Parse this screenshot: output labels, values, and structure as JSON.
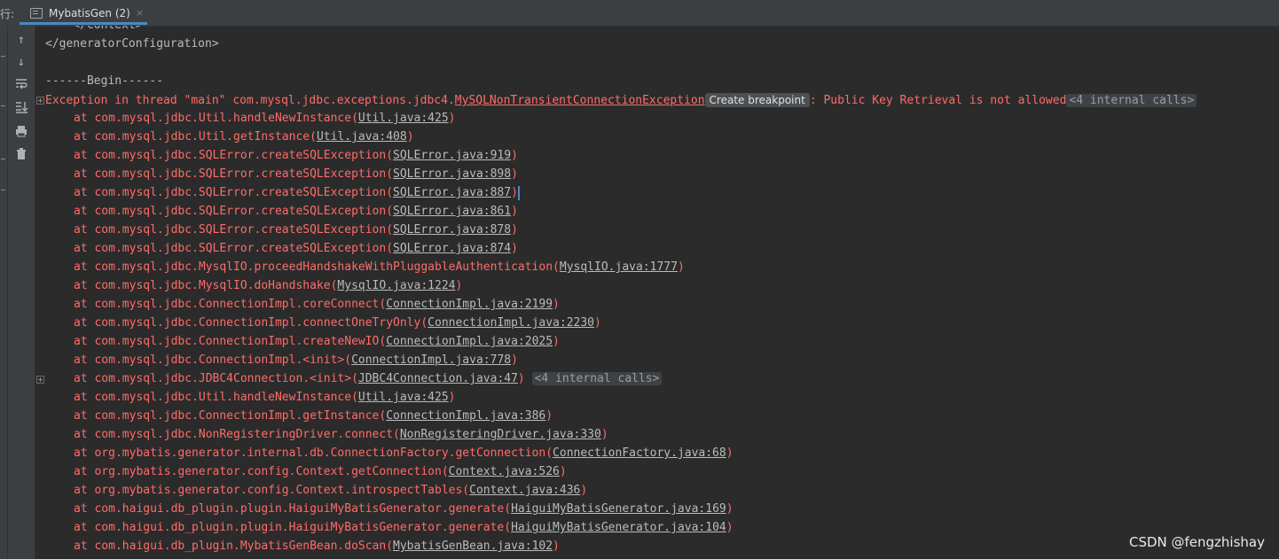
{
  "header": {
    "run_label": "行:",
    "tab_label": "MybatisGen (2)",
    "close_glyph": "×"
  },
  "toolbar": {
    "icons": [
      "up-arrow-icon",
      "down-arrow-icon",
      "soft-wrap-icon",
      "scroll-to-end-icon",
      "print-icon",
      "clear-all-icon"
    ]
  },
  "console": {
    "lines": [
      {
        "text": "    </context>",
        "kind": "plain"
      },
      {
        "text": "</generatorConfiguration>",
        "kind": "plain"
      },
      {
        "text": "",
        "kind": "plain"
      },
      {
        "text": "------Begin------",
        "kind": "plain"
      },
      {
        "kind": "exception",
        "prefix": "Exception in thread \"main\" com.mysql.jdbc.exceptions.jdbc4.",
        "exception_class": "MySQLNonTransientConnectionException",
        "breakpoint_label": "Create breakpoint",
        "message": ": Public Key Retrieval is not allowed",
        "fold": "<4 internal calls>"
      },
      {
        "kind": "frame",
        "method": "at com.mysql.jdbc.Util.handleNewInstance(",
        "source": "Util.java:425"
      },
      {
        "kind": "frame",
        "method": "at com.mysql.jdbc.Util.getInstance(",
        "source": "Util.java:408"
      },
      {
        "kind": "frame",
        "method": "at com.mysql.jdbc.SQLError.createSQLException(",
        "source": "SQLError.java:919"
      },
      {
        "kind": "frame",
        "method": "at com.mysql.jdbc.SQLError.createSQLException(",
        "source": "SQLError.java:898"
      },
      {
        "kind": "frame",
        "method": "at com.mysql.jdbc.SQLError.createSQLException(",
        "source": "SQLError.java:887"
      },
      {
        "kind": "frame",
        "method": "at com.mysql.jdbc.SQLError.createSQLException(",
        "source": "SQLError.java:861"
      },
      {
        "kind": "frame",
        "method": "at com.mysql.jdbc.SQLError.createSQLException(",
        "source": "SQLError.java:878"
      },
      {
        "kind": "frame",
        "method": "at com.mysql.jdbc.SQLError.createSQLException(",
        "source": "SQLError.java:874"
      },
      {
        "kind": "frame",
        "method": "at com.mysql.jdbc.MysqlIO.proceedHandshakeWithPluggableAuthentication(",
        "source": "MysqlIO.java:1777"
      },
      {
        "kind": "frame",
        "method": "at com.mysql.jdbc.MysqlIO.doHandshake(",
        "source": "MysqlIO.java:1224"
      },
      {
        "kind": "frame",
        "method": "at com.mysql.jdbc.ConnectionImpl.coreConnect(",
        "source": "ConnectionImpl.java:2199"
      },
      {
        "kind": "frame",
        "method": "at com.mysql.jdbc.ConnectionImpl.connectOneTryOnly(",
        "source": "ConnectionImpl.java:2230"
      },
      {
        "kind": "frame",
        "method": "at com.mysql.jdbc.ConnectionImpl.createNewIO(",
        "source": "ConnectionImpl.java:2025"
      },
      {
        "kind": "frame",
        "method": "at com.mysql.jdbc.ConnectionImpl.<init>(",
        "source": "ConnectionImpl.java:778"
      },
      {
        "kind": "frame",
        "method": "at com.mysql.jdbc.JDBC4Connection.<init>(",
        "source": "JDBC4Connection.java:47",
        "fold": "<4 internal calls>"
      },
      {
        "kind": "frame",
        "method": "at com.mysql.jdbc.Util.handleNewInstance(",
        "source": "Util.java:425"
      },
      {
        "kind": "frame",
        "method": "at com.mysql.jdbc.ConnectionImpl.getInstance(",
        "source": "ConnectionImpl.java:386"
      },
      {
        "kind": "frame",
        "method": "at com.mysql.jdbc.NonRegisteringDriver.connect(",
        "source": "NonRegisteringDriver.java:330"
      },
      {
        "kind": "frame",
        "method": "at org.mybatis.generator.internal.db.ConnectionFactory.getConnection(",
        "source": "ConnectionFactory.java:68"
      },
      {
        "kind": "frame",
        "method": "at org.mybatis.generator.config.Context.getConnection(",
        "source": "Context.java:526"
      },
      {
        "kind": "frame",
        "method": "at org.mybatis.generator.config.Context.introspectTables(",
        "source": "Context.java:436"
      },
      {
        "kind": "frame",
        "method": "at com.haigui.db_plugin.plugin.HaiguiMyBatisGenerator.generate(",
        "source": "HaiguiMyBatisGenerator.java:169"
      },
      {
        "kind": "frame",
        "method": "at com.haigui.db_plugin.plugin.HaiguiMyBatisGenerator.generate(",
        "source": "HaiguiMyBatisGenerator.java:104"
      },
      {
        "kind": "frame",
        "method": "at com.haigui.db_plugin.MybatisGenBean.doScan(",
        "source": "MybatisGenBean.java:102"
      }
    ]
  },
  "watermark": "CSDN @fengzhishay",
  "colors": {
    "error": "#ff6b68",
    "text": "#bbbbbb",
    "background": "#2b2b2b",
    "accent": "#4a88c7"
  }
}
